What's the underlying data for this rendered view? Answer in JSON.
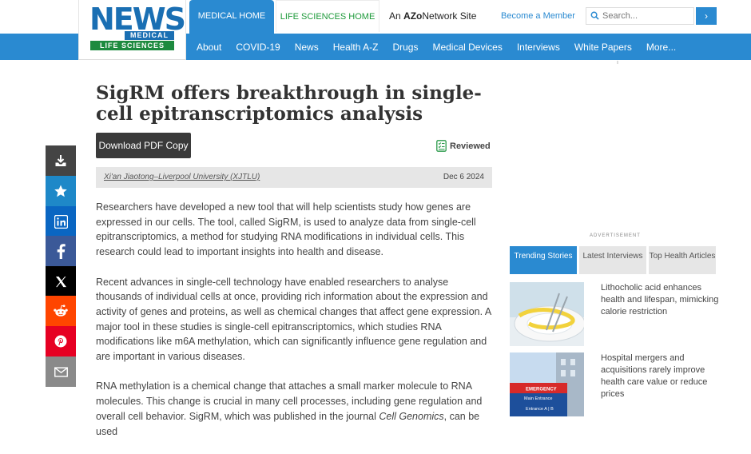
{
  "header": {
    "logo": {
      "news": "NEWS",
      "medical": "MEDICAL",
      "life_sciences": "LIFE SCIENCES"
    },
    "tab_medical": "MEDICAL HOME",
    "tab_life": "LIFE SCIENCES HOME",
    "network_prefix": "An",
    "network_brand": "AZo",
    "network_suffix": "Network Site",
    "member_link": "Become a Member",
    "search_placeholder": "Search...",
    "search_button": "›"
  },
  "nav": {
    "items": [
      "About",
      "COVID-19",
      "News",
      "Health A-Z",
      "Drugs",
      "Medical Devices",
      "Interviews",
      "White Papers",
      "More..."
    ]
  },
  "share": {
    "items": [
      {
        "icon": "download-icon",
        "color": "#444444"
      },
      {
        "icon": "star-icon",
        "color": "#1e88c8"
      },
      {
        "icon": "linkedin-icon",
        "color": "#0a66c2"
      },
      {
        "icon": "facebook-icon",
        "color": "#3b5998"
      },
      {
        "icon": "x-icon",
        "color": "#000000"
      },
      {
        "icon": "reddit-icon",
        "color": "#ff4500"
      },
      {
        "icon": "pinterest-icon",
        "color": "#e60023"
      },
      {
        "icon": "email-icon",
        "color": "#8a8a8a"
      }
    ]
  },
  "article": {
    "title": "SigRM offers breakthrough in single-cell epitranscriptomics analysis",
    "pdf_button": "Download PDF Copy",
    "reviewed": "Reviewed",
    "source": "Xi'an Jiaotong–Liverpool University (XJTLU)",
    "date": "Dec 6 2024",
    "paragraphs": [
      "Researchers have developed a new tool that will help scientists study how genes are expressed in our cells. The tool, called SigRM, is used to analyze data from single-cell epitranscriptomics, a method for studying RNA modifications in individual cells. This research could lead to important insights into health and disease.",
      "Recent advances in single-cell technology have enabled researchers to analyse thousands of individual cells at once, providing rich information about the expression and activity of genes and proteins, as well as chemical changes that affect gene expression. A major tool in these studies is single-cell epitranscriptomics, which studies RNA modifications like m6A methylation, which can significantly influence gene regulation and are important in various diseases."
    ],
    "p3_before": "RNA methylation is a chemical change that attaches a small marker molecule to RNA molecules. This change is crucial in many cell processes, including gene regulation and overall cell behavior. SigRM, which was published in the journal ",
    "p3_journal": "Cell Genomics",
    "p3_after": ", can be used"
  },
  "sidebar": {
    "ad_label": "ADVERTISEMENT",
    "tabs": [
      "Trending Stories",
      "Latest Interviews",
      "Top Health Articles"
    ],
    "stories": [
      "Lithocholic acid enhances health and lifespan, mimicking calorie restriction",
      "Hospital mergers and acquisitions rarely improve health care value or reduce prices"
    ],
    "sign_emergency": "EMERGENCY",
    "sign_main": "Main Entrance",
    "sign_entrance": "Entrance A | B"
  },
  "colors": {
    "brand_blue": "#2a8ad1",
    "brand_green": "#1d9a3a"
  }
}
